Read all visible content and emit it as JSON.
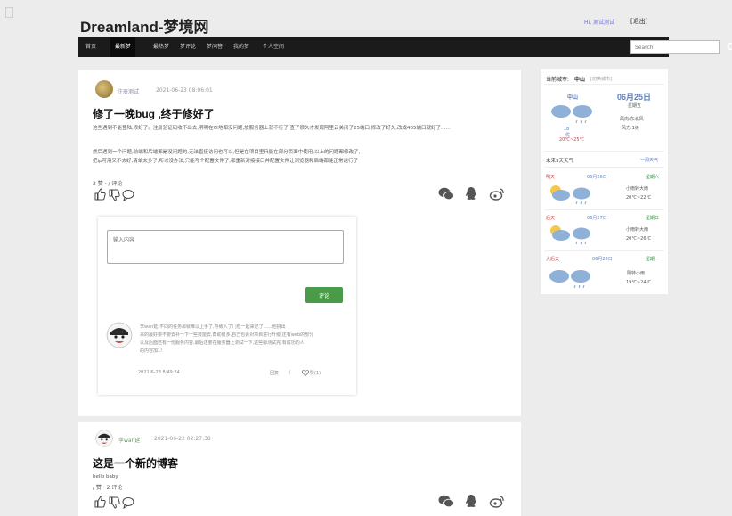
{
  "header": {
    "brand": "Dreamland-梦境网",
    "user": "Hi, 测试测试",
    "logout": "[退出]"
  },
  "nav": {
    "items": [
      "首页",
      "最新梦",
      "最热梦",
      "梦评论",
      "梦问答",
      "我的梦",
      "个人空间"
    ],
    "active_index": 1
  },
  "search": {
    "placeholder": "Search"
  },
  "posts": [
    {
      "author": "注册测试",
      "time": "2021-06-23 08:06:01",
      "title": "修了一晚bug ,终于修好了",
      "para1_line1": "这些遇到不能登陆,修好了。注册验证码收不出去,明明在本地都没问题,放服务器上就不行了,查了很久才发现阿里云关闭了25端口,修改了好久,改成465端口就好了……",
      "para2_line1": "然后遇到一个问题,前端和后端都是没问题的,无法直接访问也可以,但是在项目里只能在部分页面中使用,以上的问题都修改了,",
      "para2_line2": "把ip可用又不太好,清单太多了,所以没办法,只能写个配置文件了,都重新对接接口并配置文件让浏览器和后端都能正常运行了",
      "stats": "2 赞 · / 评论",
      "comment_placeholder": "输入内容",
      "comment_submit": "评论",
      "comment": {
        "author": "李wan延",
        "text_line1": "李wan延:不同的任务那就难以上手了,导致入了门但一起来记了……他挑出",
        "text_line2": "来的最好要不要去补一下一些技能去,帮助很多,自己也会对项目进行升级,还有web的部分",
        "text_line3": "以及后面还有一份服务内容,最后还要在服务器上测试一下,这些都测试完,有成功的人",
        "text_line4": "的内容加1!",
        "time": "2021-6-23 8:49:24",
        "reply": "回复",
        "like": "赞(1)"
      }
    },
    {
      "author": "李wan延",
      "time": "2021-06-22 02:27:38",
      "title": "这是一个新的博客",
      "body": "hello baby",
      "stats": "/ 赞 · 2 评论"
    }
  ],
  "weather": {
    "current_city_label": "当前城市:",
    "current_city": "中山",
    "switch_city": "[切换城市]",
    "today_city": "中山",
    "today_date": "06月25日",
    "today_weekday": "星期五",
    "today_wind_dir": "风向:东北风",
    "today_wind_level": "风力:1级",
    "today_aqi": "18",
    "today_aqi_label": "优",
    "today_temp": "20℃~25℃",
    "forecast_title": "未来3天天气",
    "forecast_more": "一周天气",
    "forecast": [
      {
        "day": "明天",
        "date": "06月26日",
        "weekday": "星期六",
        "desc": "小雨转大雨",
        "temp": "20℃~22℃"
      },
      {
        "day": "后天",
        "date": "06月27日",
        "weekday": "星期日",
        "desc": "小雨转大雨",
        "temp": "20℃~26℃"
      },
      {
        "day": "大后天",
        "date": "06月28日",
        "weekday": "星期一",
        "desc": "阴转小雨",
        "temp": "19℃~24℃"
      }
    ]
  },
  "colors": {
    "navbar": "#1b1b1b",
    "accent_green": "#4a9b47",
    "link_blue": "#5a7fc0",
    "warning_red": "#d43b3b"
  }
}
